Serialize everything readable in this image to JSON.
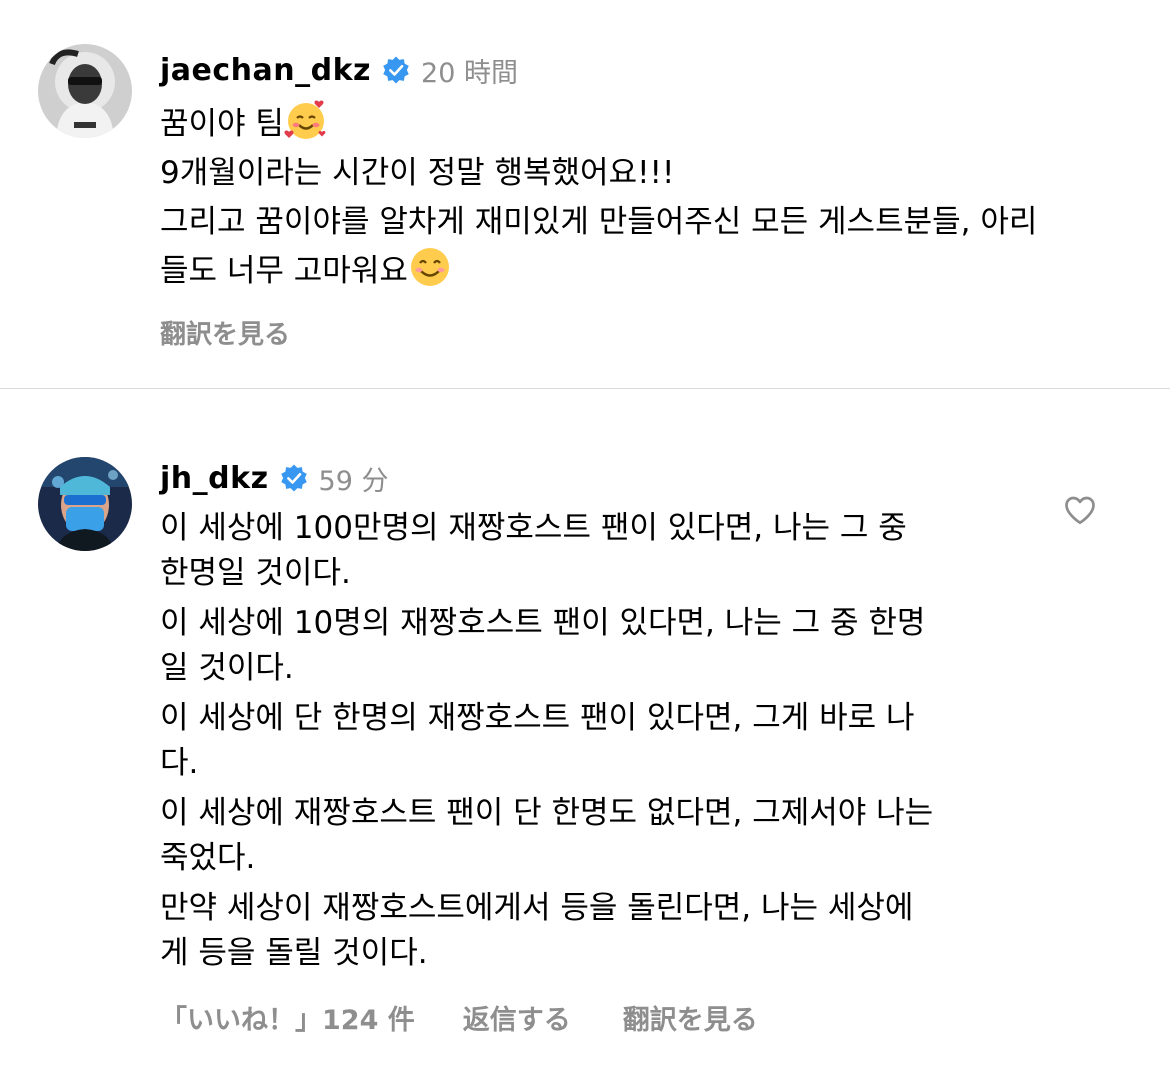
{
  "comment1": {
    "username": "jaechan_dkz",
    "timestamp": "20 時間",
    "line1": "꿈이야 팀",
    "line2": "9개월이라는 시간이 정말 행복했어요!!!",
    "line3": "그리고 꿈이야를 알차게 재미있게 만들어주신 모든 게스트분들, 아리",
    "line4": "들도 너무 고마워요",
    "translate": "翻訳を見る",
    "icons": [
      "verified-badge-icon",
      "smiling-face-with-hearts-emoji",
      "smiling-face-emoji"
    ]
  },
  "comment2": {
    "username": "jh_dkz",
    "timestamp": "59 分",
    "paragraphs": [
      "이 세상에 100만명의 재짱호스트 팬이 있다면, 나는 그 중\n한명일 것이다.",
      "이 세상에 10명의 재짱호스트 팬이 있다면, 나는 그 중 한명\n일 것이다.",
      "이 세상에 단 한명의 재짱호스트 팬이 있다면, 그게 바로 나\n다.",
      "이 세상에 재짱호스트 팬이 단 한명도 없다면, 그제서야 나는\n죽었다.",
      "만약 세상이 재짱호스트에게서 등을 돌린다면, 나는 세상에\n게 등을 돌릴 것이다."
    ],
    "likes": "「いいね！」124 件",
    "reply": "返信する",
    "translate": "翻訳を見る",
    "icons": [
      "verified-badge-icon",
      "heart-outline-icon"
    ]
  },
  "colors": {
    "verified": "#3897f0",
    "secondary_text": "#8e8e8e",
    "divider": "#dbdbdb"
  }
}
